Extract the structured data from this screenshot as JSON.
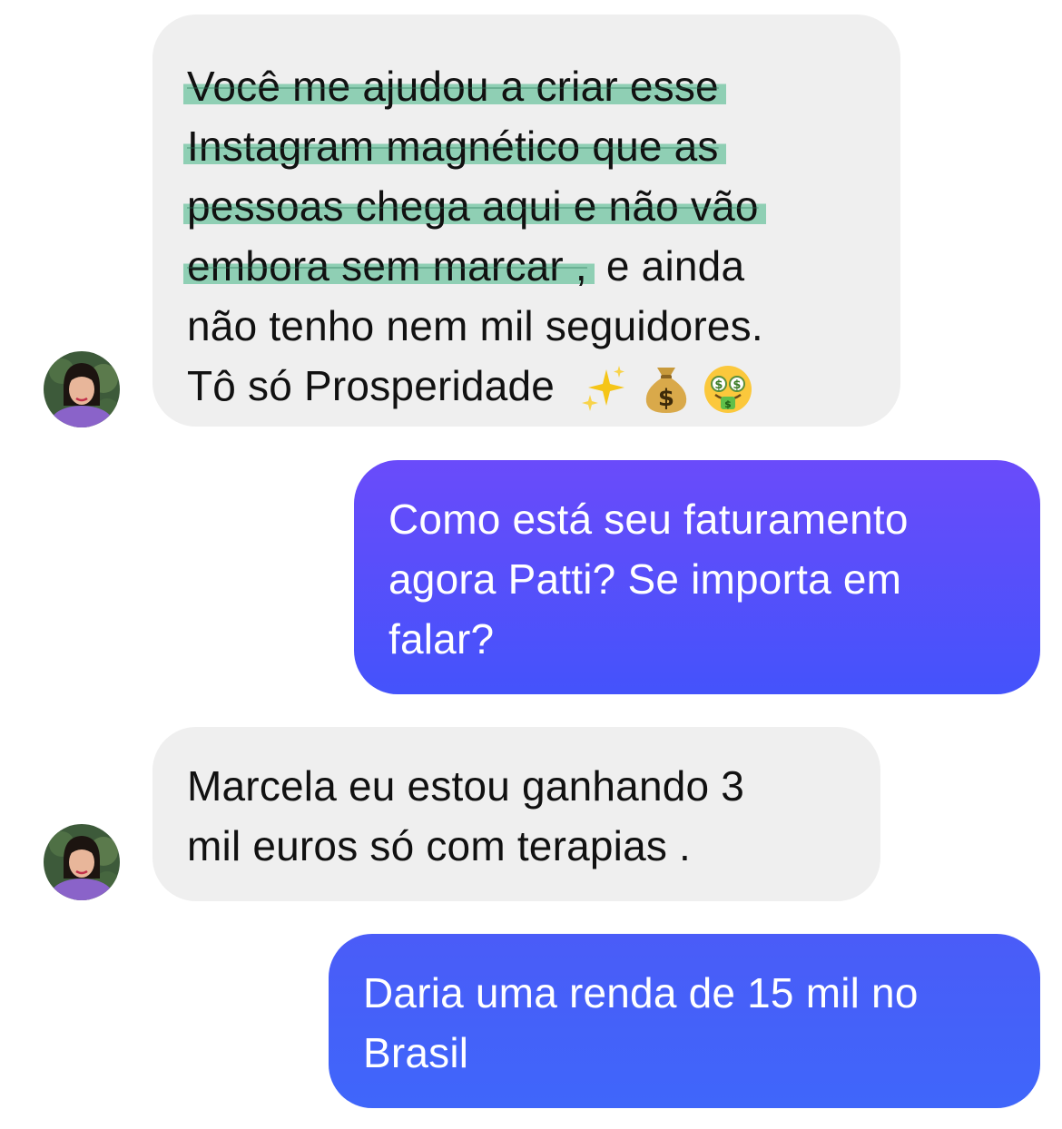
{
  "messages": [
    {
      "direction": "incoming",
      "highlighted_lines": [
        "Você me ajudou a criar esse",
        "Instagram magnético que as",
        "pessoas chega aqui e não vão",
        "embora sem marcar ,"
      ],
      "line4_rest": "e ainda",
      "line5": "não tenho nem mil seguidores.",
      "line6": "Tô só Prosperidade",
      "emojis": [
        "sparkles-icon",
        "money-bag-icon",
        "money-mouth-face-icon"
      ]
    },
    {
      "direction": "outgoing",
      "lines": [
        "Como está seu faturamento",
        "agora Patti? Se importa em",
        "falar?"
      ]
    },
    {
      "direction": "incoming",
      "lines": [
        "Marcela eu estou ganhando 3",
        "mil euros só com terapias ."
      ]
    },
    {
      "direction": "outgoing",
      "lines": [
        "Daria uma renda de 15 mil no",
        "Brasil"
      ]
    }
  ],
  "colors": {
    "incoming_bubble": "#efefef",
    "outgoing_top": "#6a4bfa",
    "outgoing_bottom": "#4453fb",
    "outgoing2_top": "#4a5cf8",
    "outgoing2_bottom": "#3f66fa",
    "highlight": "#40b584"
  }
}
